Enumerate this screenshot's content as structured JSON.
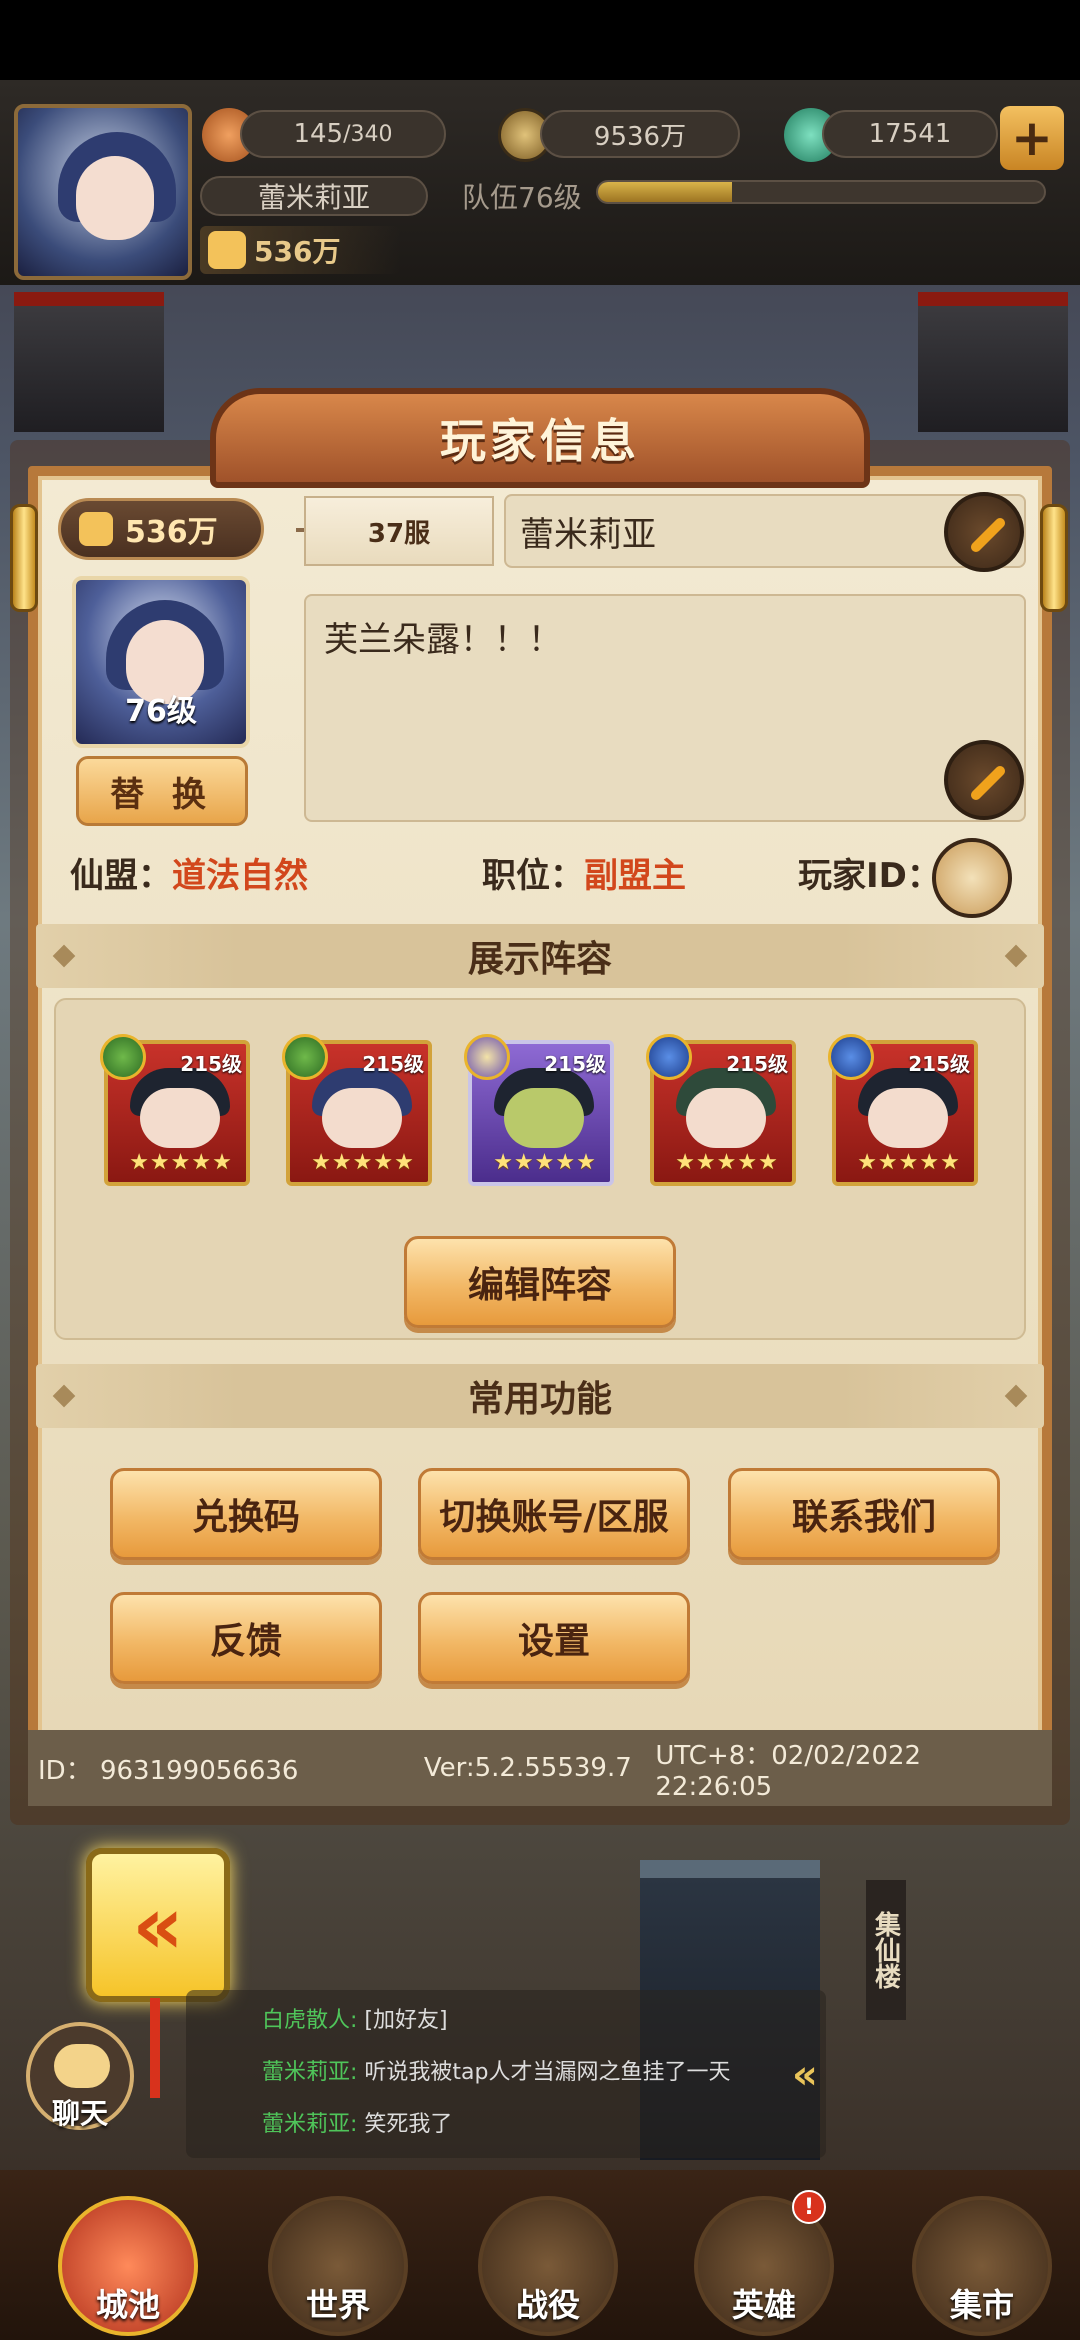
{
  "hud": {
    "stamina": "145",
    "stamina_max": "/340",
    "gold": "9536万",
    "jade": "17541",
    "player_name": "蕾米莉亚",
    "team_level": "队伍76级",
    "team_xp_fraction": 0.3,
    "power": "536万"
  },
  "dialog": {
    "title": "玩家信息",
    "power": "536万",
    "server": "37服",
    "name": "蕾米莉亚",
    "avatar_level": "76级",
    "swap_label": "替 换",
    "signature": "芙兰朵露！！！",
    "guild_label": "仙盟：",
    "guild_value": "道法自然",
    "role_label": "职位：",
    "role_value": "副盟主",
    "player_id_label": "玩家ID："
  },
  "lineup": {
    "title": "展示阵容",
    "heroes": [
      {
        "level": "215级",
        "stars": "★★★★★"
      },
      {
        "level": "215级",
        "stars": "★★★★★"
      },
      {
        "level": "215级",
        "stars": "★★★★★"
      },
      {
        "level": "215级",
        "stars": "★★★★★"
      },
      {
        "level": "215级",
        "stars": "★★★★★"
      }
    ],
    "edit_label": "编辑阵容"
  },
  "functions": {
    "title": "常用功能",
    "redeem": "兑换码",
    "switch_account": "切换账号/区服",
    "contact": "联系我们",
    "feedback": "反馈",
    "settings": "设置"
  },
  "footer": {
    "id": "ID：  963199056636",
    "version": "Ver:5.2.55539.7",
    "time": "UTC+8：02/02/2022 22:26:05"
  },
  "chat": {
    "label": "聊天",
    "lines": [
      {
        "name": "白虎散人:",
        "text": "[加好友]"
      },
      {
        "name": "蕾米莉亚:",
        "text": "听说我被tap人才当漏网之鱼挂了一天"
      },
      {
        "name": "蕾米莉亚:",
        "text": "笑死我了"
      }
    ]
  },
  "scene": {
    "sign": "集仙楼"
  },
  "tabs": [
    "城池",
    "世界",
    "战役",
    "英雄",
    "集市"
  ],
  "tab_badge": "!",
  "colors": {
    "accent_red": "#d2471c",
    "panel_bg": "#f3ead3",
    "frame": "#b7793b"
  }
}
